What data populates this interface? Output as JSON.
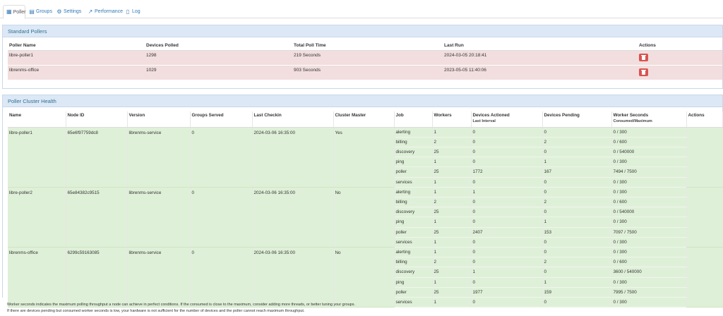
{
  "tabs": [
    {
      "label": "Poller",
      "icon": "table-icon"
    },
    {
      "label": "Groups",
      "icon": "groups-icon"
    },
    {
      "label": "Settings",
      "icon": "gears-icon"
    },
    {
      "label": "Performance",
      "icon": "line-chart-icon"
    },
    {
      "label": "Log",
      "icon": "file-icon"
    }
  ],
  "standard": {
    "title": "Standard Pollers",
    "headers": [
      "Poller Name",
      "Devices Polled",
      "Total Poll Time",
      "Last Run",
      "Actions"
    ],
    "rows": [
      [
        "libre-poller1",
        "1298",
        "219 Seconds",
        "2024-03-05 20:18:41"
      ],
      [
        "librenms-office",
        "1029",
        "903 Seconds",
        "2023-05-05 11:40:06"
      ]
    ],
    "row_color": "#f2dede",
    "delete_color": "#d9534f"
  },
  "cluster": {
    "title": "Poller Cluster Health",
    "headers": [
      "Name",
      "Node ID",
      "Version",
      "Groups Served",
      "Last Checkin",
      "Cluster Master",
      "Job",
      "Workers",
      "Devices Actioned",
      "Devices Pending",
      "Worker Seconds",
      "Actions"
    ],
    "subheaders": {
      "devices_actioned": "Last Interval",
      "worker_seconds": "Consumed/Maximum"
    },
    "row_color": "#dff0d8",
    "nodes": [
      {
        "name": "libre-poller1",
        "node_id": "65e6f97759dc8",
        "version": "librenms-service",
        "groups": "0",
        "checkin": "2024-03-06 16:35:00",
        "master": "Yes",
        "jobs": [
          [
            "alerting",
            "1",
            "0",
            "0",
            "0 / 300"
          ],
          [
            "billing",
            "2",
            "0",
            "2",
            "0 / 600"
          ],
          [
            "discovery",
            "25",
            "0",
            "0",
            "0 / 540000"
          ],
          [
            "ping",
            "1",
            "0",
            "1",
            "0 / 300"
          ],
          [
            "poller",
            "25",
            "1772",
            "167",
            "7494 / 7500"
          ],
          [
            "services",
            "1",
            "0",
            "0",
            "0 / 300"
          ]
        ]
      },
      {
        "name": "libre-poller2",
        "node_id": "65e84382c9515",
        "version": "librenms-service",
        "groups": "0",
        "checkin": "2024-03-06 16:35:00",
        "master": "No",
        "jobs": [
          [
            "alerting",
            "1",
            "1",
            "0",
            "0 / 300"
          ],
          [
            "billing",
            "2",
            "0",
            "2",
            "0 / 600"
          ],
          [
            "discovery",
            "25",
            "0",
            "0",
            "0 / 540000"
          ],
          [
            "ping",
            "1",
            "0",
            "1",
            "0 / 300"
          ],
          [
            "poller",
            "25",
            "2407",
            "153",
            "7097 / 7500"
          ],
          [
            "services",
            "1",
            "0",
            "0",
            "0 / 300"
          ]
        ]
      },
      {
        "name": "librenms-office",
        "node_id": "6299c59163085",
        "version": "librenms-service",
        "groups": "0",
        "checkin": "2024-03-06 16:35:00",
        "master": "No",
        "jobs": [
          [
            "alerting",
            "1",
            "0",
            "0",
            "0 / 300"
          ],
          [
            "billing",
            "2",
            "0",
            "2",
            "0 / 600"
          ],
          [
            "discovery",
            "25",
            "1",
            "0",
            "3600 / 540000"
          ],
          [
            "ping",
            "1",
            "0",
            "1",
            "0 / 300"
          ],
          [
            "poller",
            "25",
            "1977",
            "159",
            "7995 / 7500"
          ],
          [
            "services",
            "1",
            "0",
            "0",
            "0 / 300"
          ]
        ]
      }
    ]
  },
  "footnotes": [
    "Worker seconds indicates the maximum polling throughput a node can achieve in perfect conditions. If the consumed is close to the maximum, consider adding more threads, or better tuning your groups.",
    "If there are devices pending but consumed worker seconds is low, your hardware is not sufficient for the number of devices and the poller cannot reach maximum throughput."
  ]
}
